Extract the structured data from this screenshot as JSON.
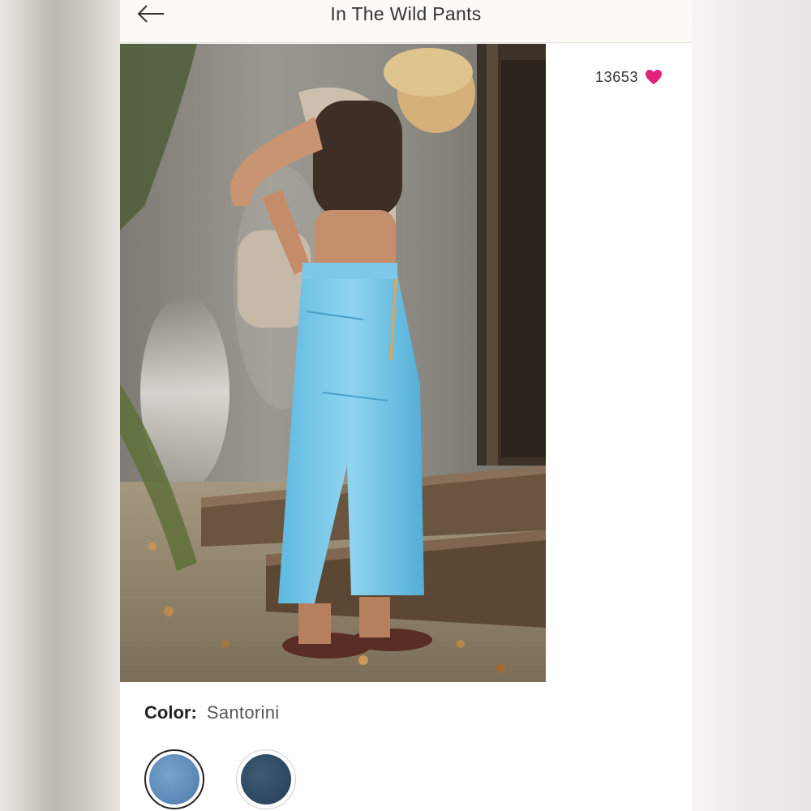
{
  "header": {
    "title": "In The Wild Pants",
    "back_icon": "arrow-left-icon"
  },
  "product": {
    "likes_count": "13653",
    "heart_icon": "heart-icon",
    "heart_color": "#e0237a",
    "color_label": "Color:",
    "color_value": "Santorini"
  },
  "swatches": [
    {
      "name": "Santorini",
      "selected": true,
      "color": "#6390bf"
    },
    {
      "name": "navy",
      "selected": false,
      "color": "#2f4a63"
    }
  ]
}
